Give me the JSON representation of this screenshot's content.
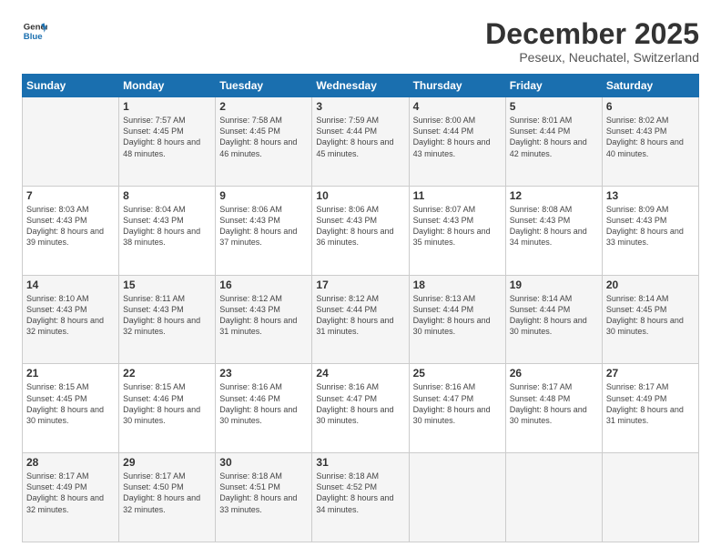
{
  "logo": {
    "line1": "General",
    "line2": "Blue"
  },
  "header": {
    "month": "December 2025",
    "location": "Peseux, Neuchatel, Switzerland"
  },
  "weekdays": [
    "Sunday",
    "Monday",
    "Tuesday",
    "Wednesday",
    "Thursday",
    "Friday",
    "Saturday"
  ],
  "weeks": [
    [
      {
        "day": "",
        "sunrise": "",
        "sunset": "",
        "daylight": ""
      },
      {
        "day": "1",
        "sunrise": "Sunrise: 7:57 AM",
        "sunset": "Sunset: 4:45 PM",
        "daylight": "Daylight: 8 hours and 48 minutes."
      },
      {
        "day": "2",
        "sunrise": "Sunrise: 7:58 AM",
        "sunset": "Sunset: 4:45 PM",
        "daylight": "Daylight: 8 hours and 46 minutes."
      },
      {
        "day": "3",
        "sunrise": "Sunrise: 7:59 AM",
        "sunset": "Sunset: 4:44 PM",
        "daylight": "Daylight: 8 hours and 45 minutes."
      },
      {
        "day": "4",
        "sunrise": "Sunrise: 8:00 AM",
        "sunset": "Sunset: 4:44 PM",
        "daylight": "Daylight: 8 hours and 43 minutes."
      },
      {
        "day": "5",
        "sunrise": "Sunrise: 8:01 AM",
        "sunset": "Sunset: 4:44 PM",
        "daylight": "Daylight: 8 hours and 42 minutes."
      },
      {
        "day": "6",
        "sunrise": "Sunrise: 8:02 AM",
        "sunset": "Sunset: 4:43 PM",
        "daylight": "Daylight: 8 hours and 40 minutes."
      }
    ],
    [
      {
        "day": "7",
        "sunrise": "Sunrise: 8:03 AM",
        "sunset": "Sunset: 4:43 PM",
        "daylight": "Daylight: 8 hours and 39 minutes."
      },
      {
        "day": "8",
        "sunrise": "Sunrise: 8:04 AM",
        "sunset": "Sunset: 4:43 PM",
        "daylight": "Daylight: 8 hours and 38 minutes."
      },
      {
        "day": "9",
        "sunrise": "Sunrise: 8:06 AM",
        "sunset": "Sunset: 4:43 PM",
        "daylight": "Daylight: 8 hours and 37 minutes."
      },
      {
        "day": "10",
        "sunrise": "Sunrise: 8:06 AM",
        "sunset": "Sunset: 4:43 PM",
        "daylight": "Daylight: 8 hours and 36 minutes."
      },
      {
        "day": "11",
        "sunrise": "Sunrise: 8:07 AM",
        "sunset": "Sunset: 4:43 PM",
        "daylight": "Daylight: 8 hours and 35 minutes."
      },
      {
        "day": "12",
        "sunrise": "Sunrise: 8:08 AM",
        "sunset": "Sunset: 4:43 PM",
        "daylight": "Daylight: 8 hours and 34 minutes."
      },
      {
        "day": "13",
        "sunrise": "Sunrise: 8:09 AM",
        "sunset": "Sunset: 4:43 PM",
        "daylight": "Daylight: 8 hours and 33 minutes."
      }
    ],
    [
      {
        "day": "14",
        "sunrise": "Sunrise: 8:10 AM",
        "sunset": "Sunset: 4:43 PM",
        "daylight": "Daylight: 8 hours and 32 minutes."
      },
      {
        "day": "15",
        "sunrise": "Sunrise: 8:11 AM",
        "sunset": "Sunset: 4:43 PM",
        "daylight": "Daylight: 8 hours and 32 minutes."
      },
      {
        "day": "16",
        "sunrise": "Sunrise: 8:12 AM",
        "sunset": "Sunset: 4:43 PM",
        "daylight": "Daylight: 8 hours and 31 minutes."
      },
      {
        "day": "17",
        "sunrise": "Sunrise: 8:12 AM",
        "sunset": "Sunset: 4:44 PM",
        "daylight": "Daylight: 8 hours and 31 minutes."
      },
      {
        "day": "18",
        "sunrise": "Sunrise: 8:13 AM",
        "sunset": "Sunset: 4:44 PM",
        "daylight": "Daylight: 8 hours and 30 minutes."
      },
      {
        "day": "19",
        "sunrise": "Sunrise: 8:14 AM",
        "sunset": "Sunset: 4:44 PM",
        "daylight": "Daylight: 8 hours and 30 minutes."
      },
      {
        "day": "20",
        "sunrise": "Sunrise: 8:14 AM",
        "sunset": "Sunset: 4:45 PM",
        "daylight": "Daylight: 8 hours and 30 minutes."
      }
    ],
    [
      {
        "day": "21",
        "sunrise": "Sunrise: 8:15 AM",
        "sunset": "Sunset: 4:45 PM",
        "daylight": "Daylight: 8 hours and 30 minutes."
      },
      {
        "day": "22",
        "sunrise": "Sunrise: 8:15 AM",
        "sunset": "Sunset: 4:46 PM",
        "daylight": "Daylight: 8 hours and 30 minutes."
      },
      {
        "day": "23",
        "sunrise": "Sunrise: 8:16 AM",
        "sunset": "Sunset: 4:46 PM",
        "daylight": "Daylight: 8 hours and 30 minutes."
      },
      {
        "day": "24",
        "sunrise": "Sunrise: 8:16 AM",
        "sunset": "Sunset: 4:47 PM",
        "daylight": "Daylight: 8 hours and 30 minutes."
      },
      {
        "day": "25",
        "sunrise": "Sunrise: 8:16 AM",
        "sunset": "Sunset: 4:47 PM",
        "daylight": "Daylight: 8 hours and 30 minutes."
      },
      {
        "day": "26",
        "sunrise": "Sunrise: 8:17 AM",
        "sunset": "Sunset: 4:48 PM",
        "daylight": "Daylight: 8 hours and 30 minutes."
      },
      {
        "day": "27",
        "sunrise": "Sunrise: 8:17 AM",
        "sunset": "Sunset: 4:49 PM",
        "daylight": "Daylight: 8 hours and 31 minutes."
      }
    ],
    [
      {
        "day": "28",
        "sunrise": "Sunrise: 8:17 AM",
        "sunset": "Sunset: 4:49 PM",
        "daylight": "Daylight: 8 hours and 32 minutes."
      },
      {
        "day": "29",
        "sunrise": "Sunrise: 8:17 AM",
        "sunset": "Sunset: 4:50 PM",
        "daylight": "Daylight: 8 hours and 32 minutes."
      },
      {
        "day": "30",
        "sunrise": "Sunrise: 8:18 AM",
        "sunset": "Sunset: 4:51 PM",
        "daylight": "Daylight: 8 hours and 33 minutes."
      },
      {
        "day": "31",
        "sunrise": "Sunrise: 8:18 AM",
        "sunset": "Sunset: 4:52 PM",
        "daylight": "Daylight: 8 hours and 34 minutes."
      },
      {
        "day": "",
        "sunrise": "",
        "sunset": "",
        "daylight": ""
      },
      {
        "day": "",
        "sunrise": "",
        "sunset": "",
        "daylight": ""
      },
      {
        "day": "",
        "sunrise": "",
        "sunset": "",
        "daylight": ""
      }
    ]
  ]
}
